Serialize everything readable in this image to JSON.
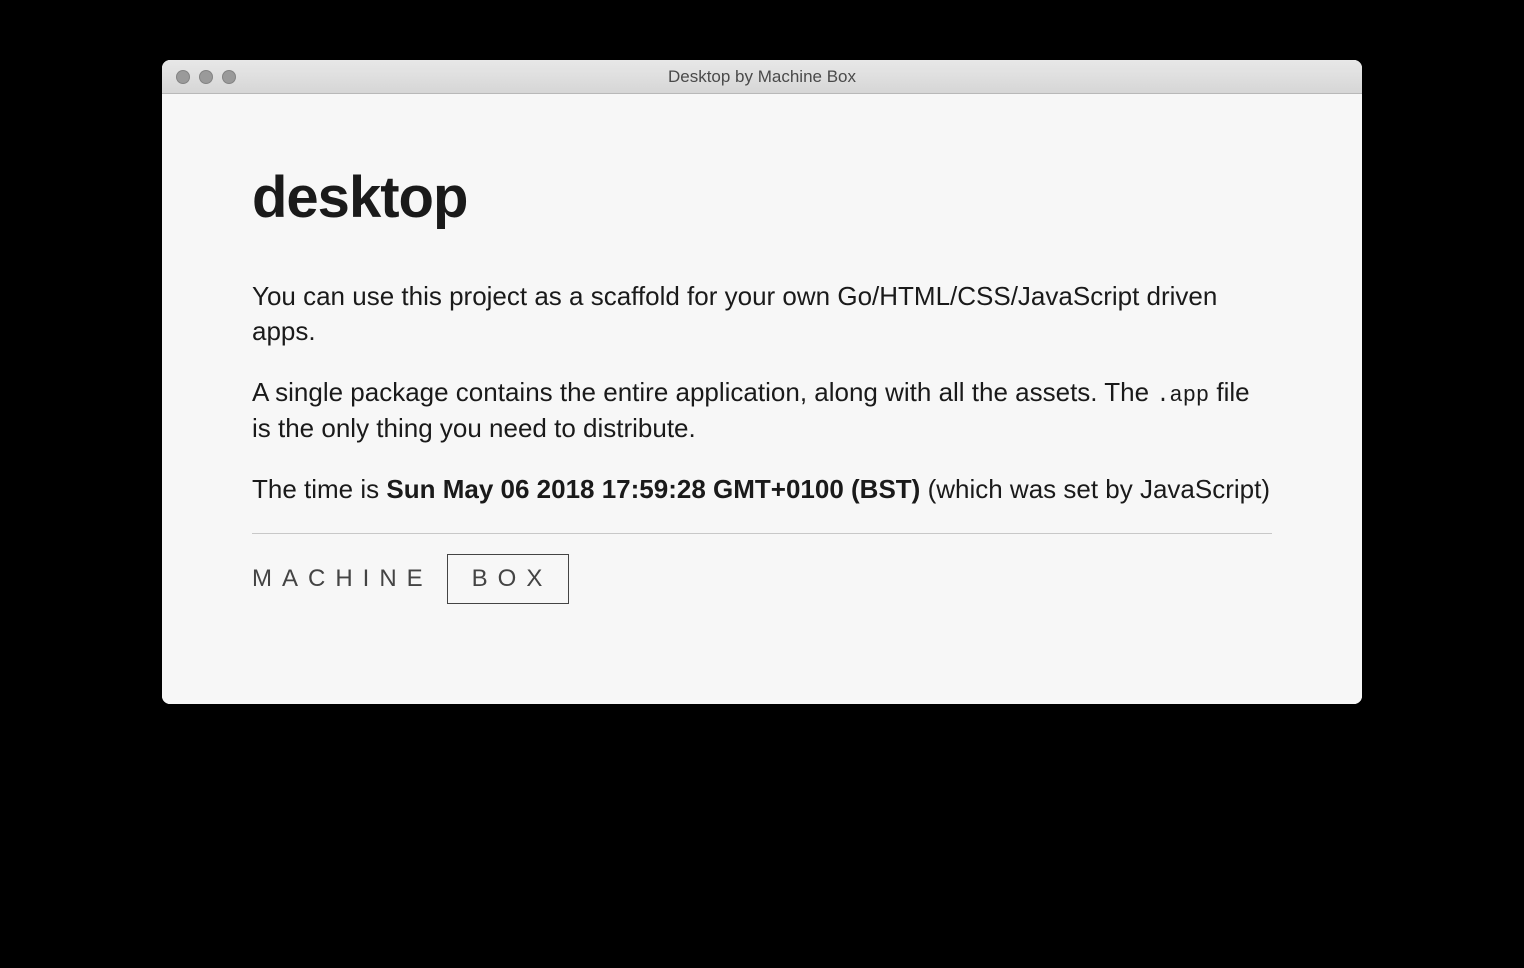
{
  "window": {
    "title": "Desktop by Machine Box"
  },
  "content": {
    "heading": "desktop",
    "para1": "You can use this project as a scaffold for your own Go/HTML/CSS/JavaScript driven apps.",
    "para2_before": "A single package contains the entire application, along with all the assets. The ",
    "para2_code": ".app",
    "para2_after": " file is the only thing you need to distribute.",
    "time_before": "The time is ",
    "time_value": "Sun May 06 2018 17:59:28 GMT+0100 (BST)",
    "time_after": " (which was set by JavaScript)"
  },
  "logo": {
    "word1": "MACHINE",
    "word2": "BOX"
  }
}
